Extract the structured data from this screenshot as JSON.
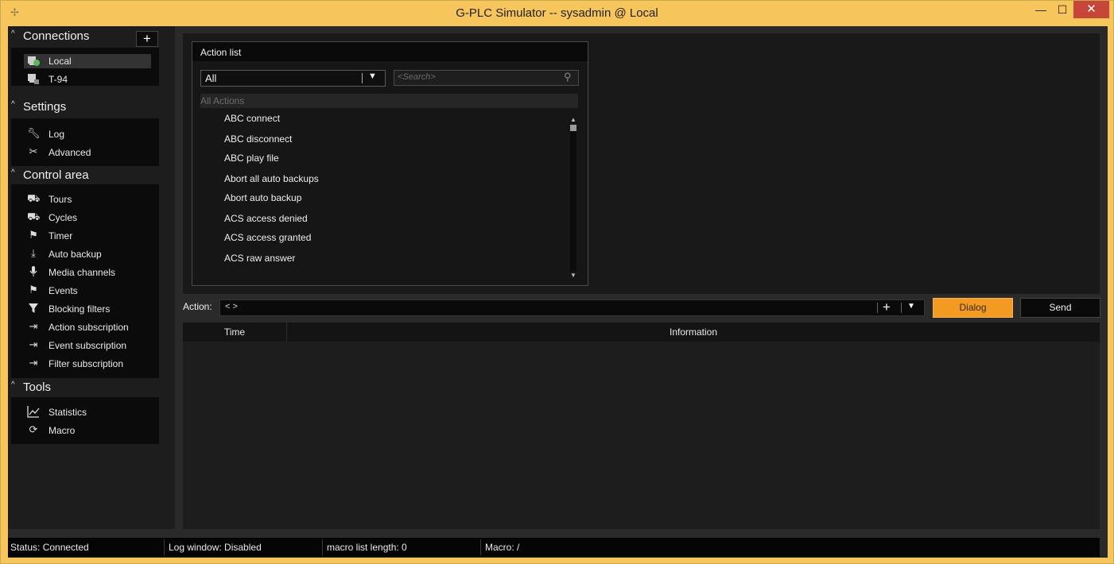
{
  "window": {
    "title": "G-PLC Simulator -- sysadmin @ Local",
    "minimize_label": "—",
    "maximize_label": "☐",
    "close_label": "✕"
  },
  "sidebar": {
    "connections": {
      "title": "Connections",
      "add_label": "+",
      "items": [
        {
          "label": "Local",
          "icon": "server-connected-icon",
          "selected": true
        },
        {
          "label": "T-94",
          "icon": "server-icon"
        }
      ]
    },
    "settings": {
      "title": "Settings",
      "items": [
        {
          "label": "Log",
          "icon": "wrench-icon"
        },
        {
          "label": "Advanced",
          "icon": "advanced-tools-icon"
        }
      ]
    },
    "control_area": {
      "title": "Control area",
      "items": [
        {
          "label": "Tours",
          "icon": "camera-tours-icon"
        },
        {
          "label": "Cycles",
          "icon": "camera-cycles-icon"
        },
        {
          "label": "Timer",
          "icon": "timer-icon"
        },
        {
          "label": "Auto backup",
          "icon": "download-icon"
        },
        {
          "label": "Media channels",
          "icon": "microphone-icon"
        },
        {
          "label": "Events",
          "icon": "flag-icon"
        },
        {
          "label": "Blocking filters",
          "icon": "filter-icon"
        },
        {
          "label": "Action subscription",
          "icon": "subscription-arrow-icon"
        },
        {
          "label": "Event subscription",
          "icon": "subscription-arrow-icon"
        },
        {
          "label": "Filter subscription",
          "icon": "subscription-arrow-icon"
        }
      ]
    },
    "tools": {
      "title": "Tools",
      "items": [
        {
          "label": "Statistics",
          "icon": "line-chart-icon"
        },
        {
          "label": "Macro",
          "icon": "refresh-icon"
        }
      ]
    }
  },
  "action_list": {
    "title": "Action list",
    "filter_value": "All",
    "search_placeholder": "<Search>",
    "group_label": "All Actions",
    "items": [
      "ABC connect",
      "ABC disconnect",
      "ABC play file",
      "Abort all auto backups",
      "Abort auto backup",
      "ACS access denied",
      "ACS access granted",
      "ACS raw answer"
    ]
  },
  "action_bar": {
    "label": "Action:",
    "value": "< >",
    "add_label": "+",
    "dropdown_label": "▼",
    "dialog_label": "Dialog",
    "send_label": "Send"
  },
  "log_table": {
    "columns": [
      "Time",
      "Information"
    ]
  },
  "status": {
    "status": "Status:  Connected",
    "log_window": "Log window: Disabled",
    "macro_list": "macro list length: 0",
    "macro": "Macro: /"
  },
  "colors": {
    "frame": "#f6c55b",
    "dialog_button": "#f39a23",
    "close_button": "#c7463a"
  }
}
